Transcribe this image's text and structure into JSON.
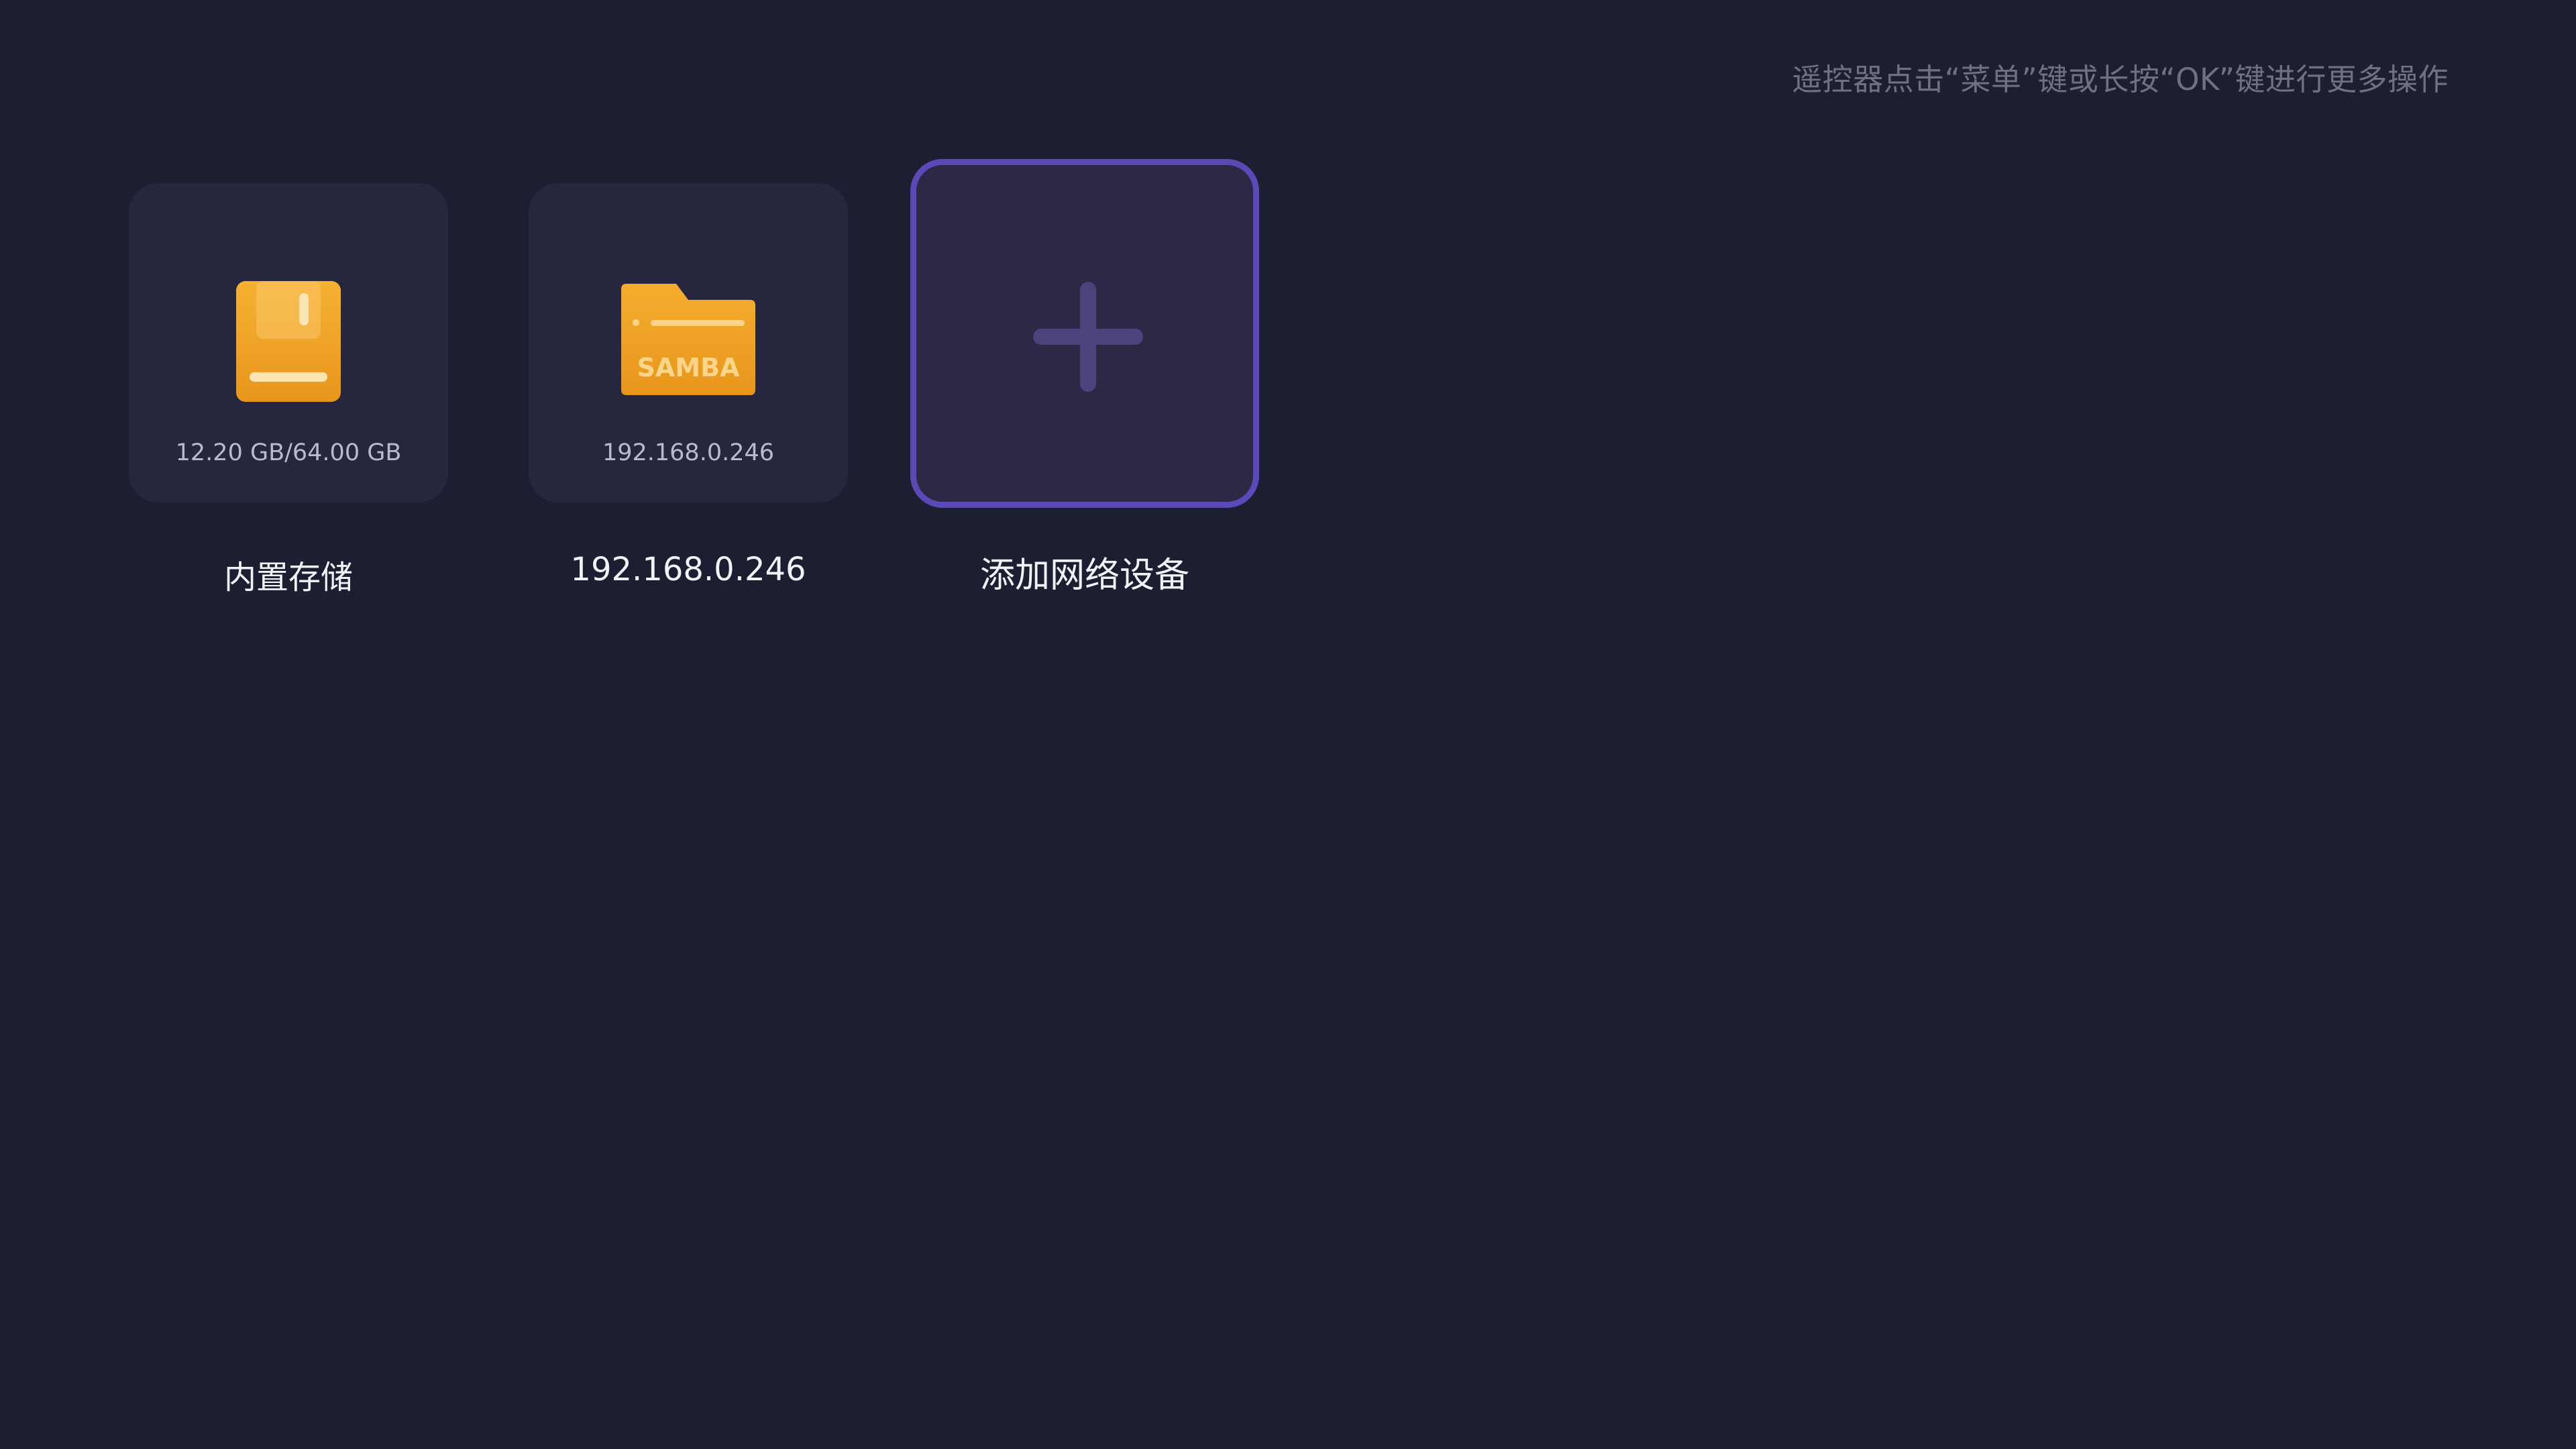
{
  "hint": "遥控器点击“菜单”键或长按“OK”键进行更多操作",
  "devices": [
    {
      "label": "内置存储",
      "sub": "12.20 GB/64.00 GB",
      "icon": "storage-card-icon"
    },
    {
      "label": "192.168.0.246",
      "sub": "192.168.0.246",
      "icon": "samba-folder-icon",
      "icon_text": "SAMBA"
    }
  ],
  "add_device": {
    "label": "添加网络设备",
    "icon": "plus-icon"
  },
  "colors": {
    "background": "#1c1f31",
    "tile": "#26273f",
    "focus_border": "#5a49b6",
    "icon_orange": "#f0a326",
    "plus": "#4b437e"
  }
}
